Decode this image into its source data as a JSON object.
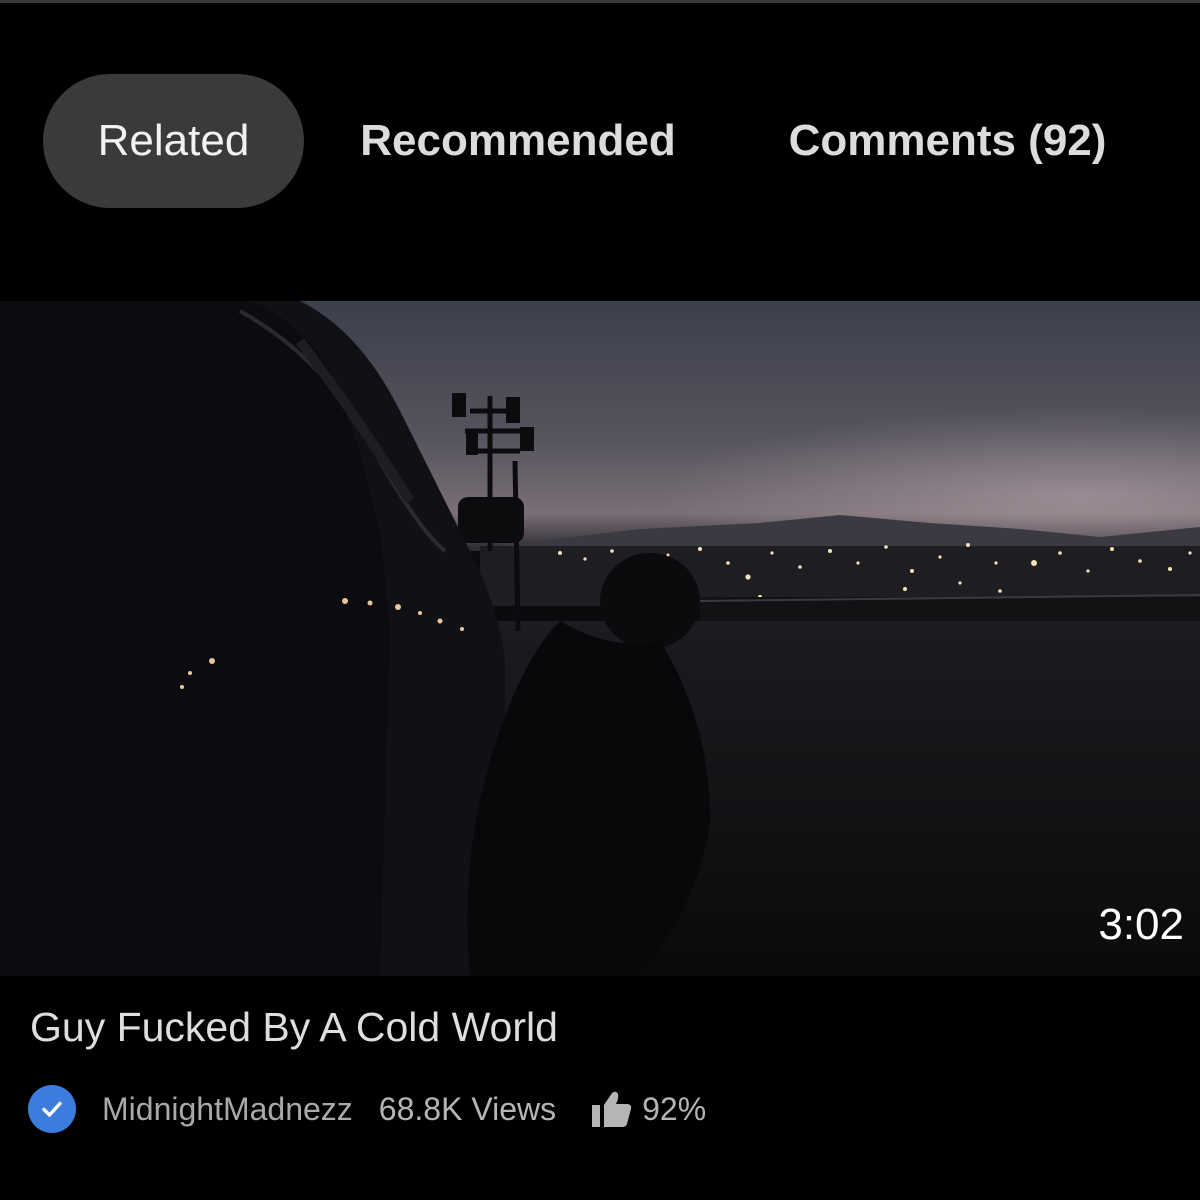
{
  "tabs": [
    {
      "label": "Related",
      "active": true
    },
    {
      "label": "Recommended",
      "active": false
    },
    {
      "label": "Comments (92)",
      "active": false
    }
  ],
  "video": {
    "duration": "3:02",
    "title": "Guy Fucked By A Cold World",
    "channel": "MidnightMadnezz",
    "verified": true,
    "views": "68.8K Views",
    "rating": "92%"
  },
  "icons": {
    "verified": "verified-check-icon",
    "rating": "thumbs-up-icon"
  },
  "colors": {
    "background": "#000000",
    "active_tab": "#3a3a3a",
    "verified_badge": "#3b7ddd"
  }
}
